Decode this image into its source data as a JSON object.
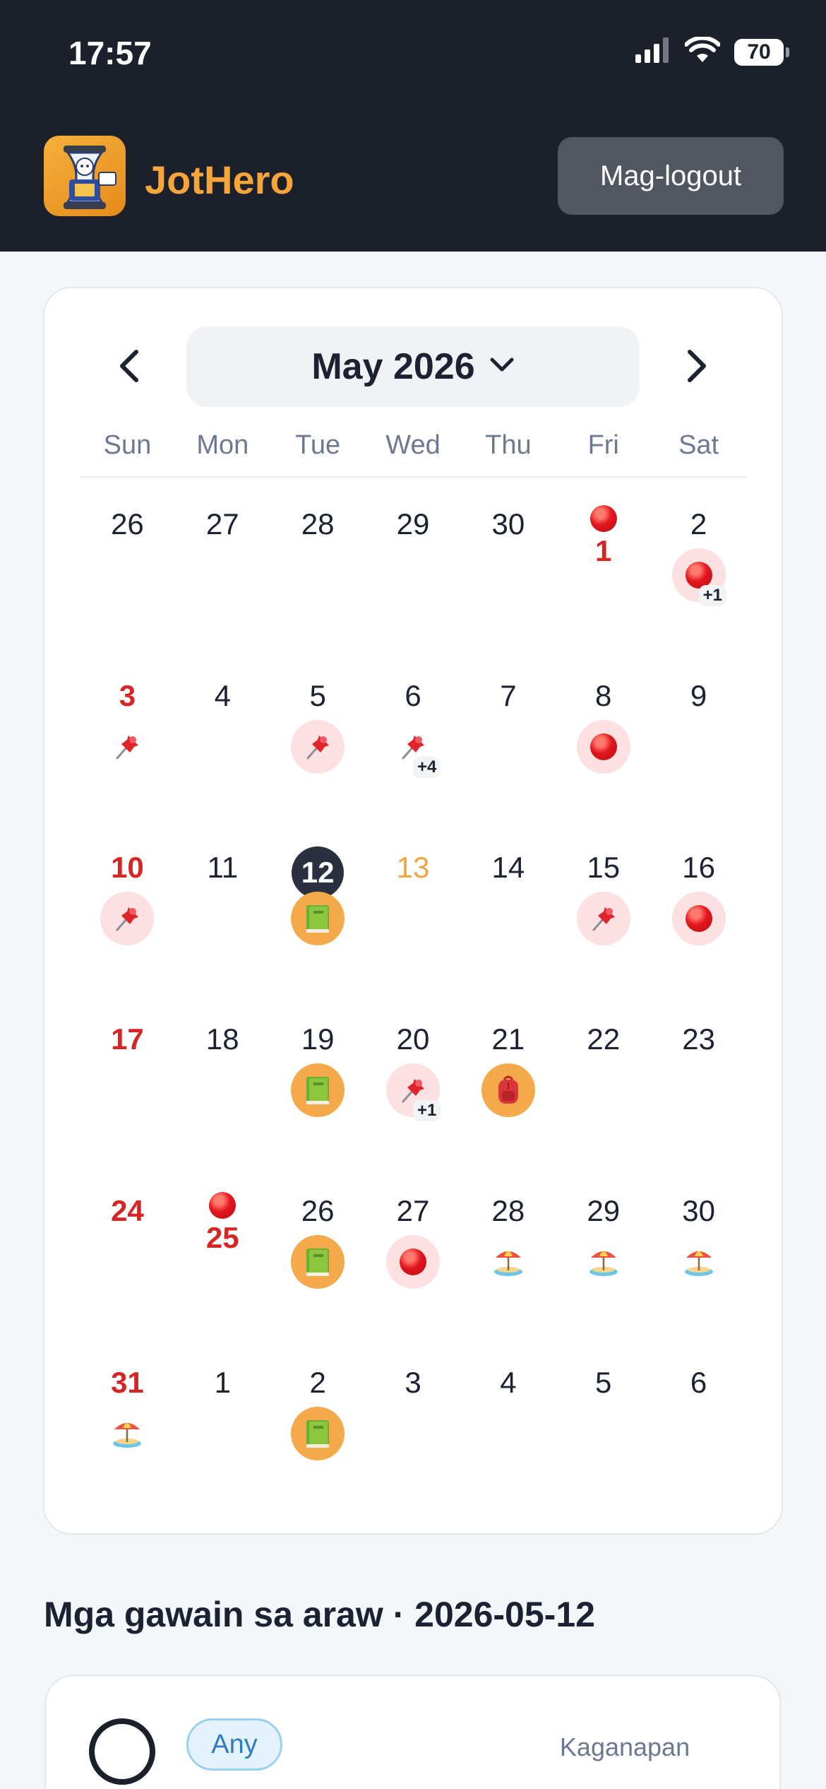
{
  "status_bar": {
    "time": "17:57",
    "battery": "70"
  },
  "header": {
    "app_name": "JotHero",
    "logout_label": "Mag-logout"
  },
  "calendar": {
    "month_label": "May 2026",
    "weekdays": [
      "Sun",
      "Mon",
      "Tue",
      "Wed",
      "Thu",
      "Fri",
      "Sat"
    ],
    "weeks": [
      [
        {
          "num": "26"
        },
        {
          "num": "27"
        },
        {
          "num": "28"
        },
        {
          "num": "29"
        },
        {
          "num": "30"
        },
        {
          "num": "1",
          "style": "red",
          "top_icon": "red-circle-icon"
        },
        {
          "num": "2",
          "bubble": "pink",
          "icon": "red-circle-icon",
          "more": "+1"
        }
      ],
      [
        {
          "num": "3",
          "style": "red",
          "bubble": "plain",
          "icon": "pushpin-icon"
        },
        {
          "num": "4"
        },
        {
          "num": "5",
          "bubble": "pink",
          "icon": "pushpin-icon"
        },
        {
          "num": "6",
          "bubble": "plain",
          "icon": "pushpin-icon",
          "more": "+4"
        },
        {
          "num": "7"
        },
        {
          "num": "8",
          "bubble": "pink",
          "icon": "red-circle-icon"
        },
        {
          "num": "9"
        }
      ],
      [
        {
          "num": "10",
          "style": "red",
          "bubble": "pink",
          "icon": "pushpin-icon"
        },
        {
          "num": "11"
        },
        {
          "num": "12",
          "today": true,
          "bubble": "orange",
          "icon": "book-icon"
        },
        {
          "num": "13",
          "style": "orange"
        },
        {
          "num": "14"
        },
        {
          "num": "15",
          "bubble": "pink",
          "icon": "pushpin-icon"
        },
        {
          "num": "16",
          "bubble": "pink",
          "icon": "red-circle-icon"
        }
      ],
      [
        {
          "num": "17",
          "style": "red"
        },
        {
          "num": "18"
        },
        {
          "num": "19",
          "bubble": "orange",
          "icon": "book-icon"
        },
        {
          "num": "20",
          "bubble": "pink",
          "icon": "pushpin-icon",
          "more": "+1"
        },
        {
          "num": "21",
          "bubble": "orange",
          "icon": "backpack-icon"
        },
        {
          "num": "22"
        },
        {
          "num": "23"
        }
      ],
      [
        {
          "num": "24",
          "style": "red"
        },
        {
          "num": "25",
          "style": "red",
          "top_icon": "red-circle-icon"
        },
        {
          "num": "26",
          "bubble": "orange",
          "icon": "book-icon"
        },
        {
          "num": "27",
          "bubble": "pink",
          "icon": "red-circle-icon"
        },
        {
          "num": "28",
          "bubble": "plain",
          "icon": "beach-umbrella-icon"
        },
        {
          "num": "29",
          "bubble": "plain",
          "icon": "beach-umbrella-icon"
        },
        {
          "num": "30",
          "bubble": "plain",
          "icon": "beach-umbrella-icon"
        }
      ],
      [
        {
          "num": "31",
          "style": "red",
          "bubble": "plain",
          "icon": "beach-umbrella-icon"
        },
        {
          "num": "1"
        },
        {
          "num": "2",
          "bubble": "orange",
          "icon": "book-icon"
        },
        {
          "num": "3"
        },
        {
          "num": "4"
        },
        {
          "num": "5"
        },
        {
          "num": "6"
        }
      ]
    ]
  },
  "tasks_section": {
    "title": "Mga gawain sa araw · 2026-05-12",
    "tasks": [
      {
        "badge": "Any",
        "type": "Kaganapan"
      }
    ]
  },
  "colors": {
    "header_bg": "#1b202b",
    "brand": "#f6a53b",
    "weekend_red": "#d52626",
    "today_bg": "#2a3040"
  }
}
